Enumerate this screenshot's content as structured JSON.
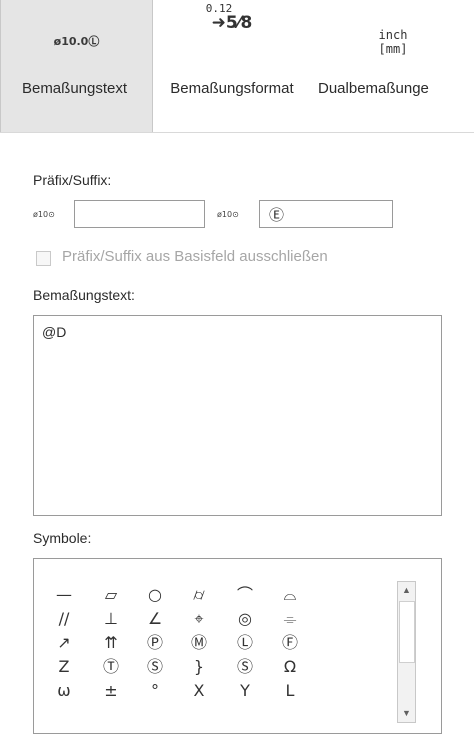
{
  "tabs": [
    {
      "label": "Bemaßungstext",
      "icon": "ø10.0Ⓛ"
    },
    {
      "label": "Bemaßungsformat",
      "icon_top": "0.12",
      "icon_bottom": "➜5⁄8"
    },
    {
      "label": "Dualbemaßunge",
      "icon_line1": "inch",
      "icon_line2": "[mm]"
    }
  ],
  "prefix_suffix": {
    "label": "Präfix/Suffix:",
    "prefix_icon": "ø10⊙",
    "prefix_value": "",
    "suffix_icon": "ø10⊙",
    "suffix_value": "Ⓔ",
    "exclude_label": "Präfix/Suffix aus Basisfeld ausschließen"
  },
  "dim_text": {
    "label": "Bemaßungstext:",
    "value": "@D"
  },
  "symbols": {
    "label": "Symbole:",
    "rows": [
      [
        "—",
        "▱",
        "○",
        "⌭",
        "⌒",
        "⌓"
      ],
      [
        "//",
        "⊥",
        "∠",
        "⌖",
        "◎",
        "⌯"
      ],
      [
        "↗",
        "⇈",
        "Ⓟ",
        "Ⓜ",
        "Ⓛ",
        "Ⓕ"
      ],
      [
        "Z",
        "Ⓣ",
        "Ⓢ",
        "}",
        "Ⓢ",
        "Ω"
      ],
      [
        "ω",
        "±",
        "°",
        "X",
        "Y",
        "L"
      ]
    ]
  },
  "colors": {
    "active_tab_bg": "#e5e5e5",
    "border": "#9a9a9a",
    "disabled_text": "#a6a6a6"
  }
}
